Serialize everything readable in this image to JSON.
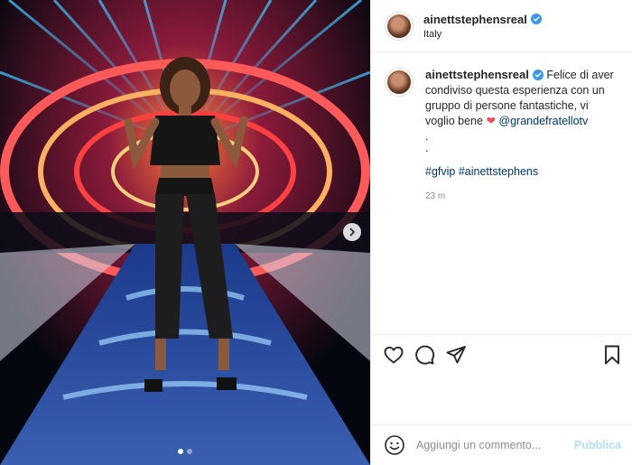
{
  "post": {
    "username": "ainettstephensreal",
    "location": "Italy",
    "verified": true
  },
  "caption": {
    "username": "ainettstephensreal",
    "text": "Felice di aver condiviso questa esperienza con un gruppo di persone fantastiche, vi voglio bene",
    "heart": "❤",
    "mention": "@grandefratellotv",
    "dot1": ".",
    "dot2": ".",
    "hashtag1": "#gfvip",
    "hashtag2": "#ainettstephens",
    "time": "23 m"
  },
  "carousel": {
    "count": 2,
    "active_index": 0
  },
  "icons": {
    "like": "heart-outline-icon",
    "comment": "comment-bubble-icon",
    "share": "paper-plane-icon",
    "save": "bookmark-icon",
    "emoji": "smiley-icon",
    "next": "chevron-right-icon"
  },
  "composer": {
    "placeholder": "Aggiungi un commento...",
    "publish_label": "Pubblica"
  },
  "colors": {
    "link": "#00376b",
    "heart": "#ed4956",
    "publish_disabled": "#b2dffc",
    "meta": "#8e8e8e"
  }
}
